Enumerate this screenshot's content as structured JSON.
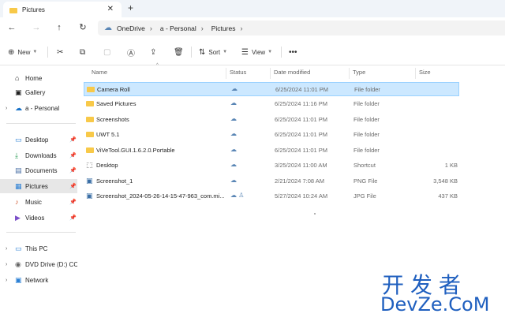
{
  "window": {
    "tab_title": "Pictures",
    "tab_close": "✕",
    "new_tab": "+"
  },
  "address": {
    "back": "←",
    "forward": "→",
    "up": "↑",
    "refresh": "↻",
    "breadcrumbs": [
      "OneDrive",
      "a - Personal",
      "Pictures"
    ],
    "separator": "›"
  },
  "toolbar": {
    "new_label": "New",
    "sort_label": "Sort",
    "view_label": "View",
    "more_label": "•••"
  },
  "sidebar": {
    "items": [
      {
        "label": "Home",
        "icon": "home-icon",
        "glyph": "⌂"
      },
      {
        "label": "Gallery",
        "icon": "gallery-icon",
        "glyph": "▣"
      },
      {
        "label": "a - Personal",
        "icon": "cloud-icon",
        "glyph": "☁"
      },
      {
        "label": "Desktop",
        "icon": "desktop-icon",
        "glyph": "▭"
      },
      {
        "label": "Downloads",
        "icon": "download-icon",
        "glyph": "⤓"
      },
      {
        "label": "Documents",
        "icon": "documents-icon",
        "glyph": "▤"
      },
      {
        "label": "Pictures",
        "icon": "pictures-icon",
        "glyph": "▦"
      },
      {
        "label": "Music",
        "icon": "music-icon",
        "glyph": "♪"
      },
      {
        "label": "Videos",
        "icon": "videos-icon",
        "glyph": "▶"
      },
      {
        "label": "This PC",
        "icon": "pc-icon",
        "glyph": "▭"
      },
      {
        "label": "DVD Drive (D:) CCC",
        "icon": "dvd-icon",
        "glyph": "◉"
      },
      {
        "label": "Network",
        "icon": "network-icon",
        "glyph": "▣"
      }
    ],
    "pin": "📌",
    "chevron": "›"
  },
  "columns": {
    "name": "Name",
    "status": "Status",
    "date": "Date modified",
    "type": "Type",
    "size": "Size"
  },
  "files": [
    {
      "name": "Camera Roll",
      "date": "6/25/2024 11:01 PM",
      "type": "File folder",
      "size": "",
      "status": "☁",
      "kind": "folder"
    },
    {
      "name": "Saved Pictures",
      "date": "6/25/2024 11:16 PM",
      "type": "File folder",
      "size": "",
      "status": "☁",
      "kind": "folder"
    },
    {
      "name": "Screenshots",
      "date": "6/25/2024 11:01 PM",
      "type": "File folder",
      "size": "",
      "status": "☁",
      "kind": "folder"
    },
    {
      "name": "UWT 5.1",
      "date": "6/25/2024 11:01 PM",
      "type": "File folder",
      "size": "",
      "status": "☁",
      "kind": "folder"
    },
    {
      "name": "ViVeTool.GUI.1.6.2.0.Portable",
      "date": "6/25/2024 11:01 PM",
      "type": "File folder",
      "size": "",
      "status": "☁",
      "kind": "folder"
    },
    {
      "name": "Desktop",
      "date": "3/25/2024 11:00 AM",
      "type": "Shortcut",
      "size": "1 KB",
      "status": "☁",
      "kind": "shortcut"
    },
    {
      "name": "Screenshot_1",
      "date": "2/21/2024 7:08 AM",
      "type": "PNG File",
      "size": "3,548 KB",
      "status": "☁",
      "kind": "image"
    },
    {
      "name": "Screenshot_2024-05-26-14-15-47-963_com.mi...",
      "date": "5/27/2024 10:24 AM",
      "type": "JPG File",
      "size": "437 KB",
      "status": "☁ ♙",
      "kind": "image"
    }
  ],
  "watermark": {
    "line1": "开发者",
    "line2": "DevZe.CoM"
  },
  "colors": {
    "selection": "#cce8ff",
    "folder": "#f8c949",
    "accent": "#1f5fbf"
  }
}
